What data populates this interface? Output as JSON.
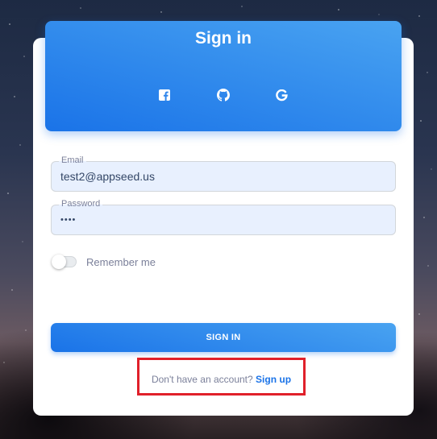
{
  "header": {
    "title": "Sign in",
    "social_icons": [
      "facebook-icon",
      "github-icon",
      "google-icon"
    ]
  },
  "form": {
    "email": {
      "label": "Email",
      "value": "test2@appseed.us"
    },
    "password": {
      "label": "Password",
      "value": "••••"
    },
    "remember": {
      "label": "Remember me",
      "checked": false
    },
    "submit_label": "SIGN IN"
  },
  "footer": {
    "prompt": "Don't have an account?",
    "link_label": "Sign up"
  },
  "colors": {
    "accent": "#1a73e8",
    "accent_light": "#49a3f1",
    "highlight": "#e0202a",
    "field_bg": "#e8f0fe"
  }
}
